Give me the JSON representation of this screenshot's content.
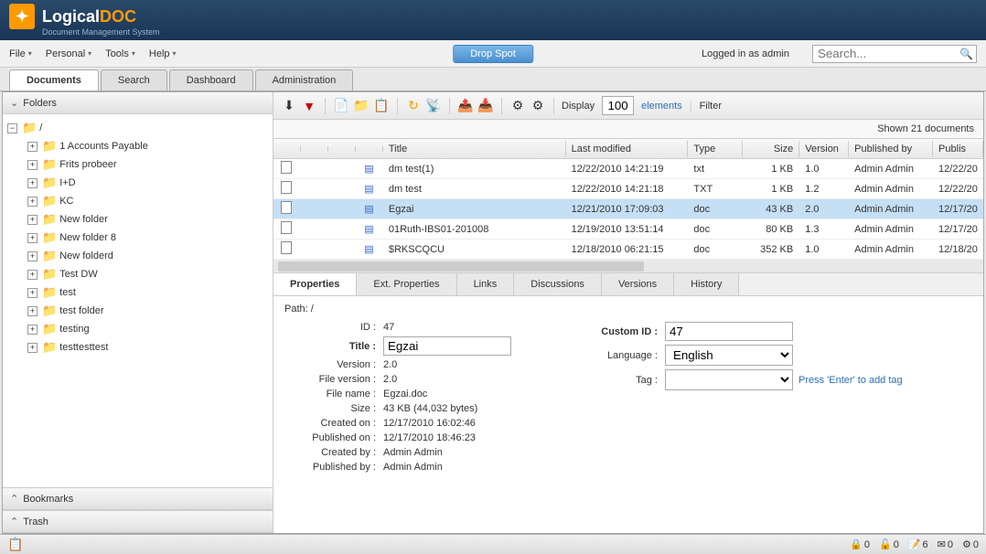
{
  "brand": {
    "name1": "Logical",
    "name2": "DOC",
    "subtitle": "Document Management System"
  },
  "menu": {
    "file": "File",
    "personal": "Personal",
    "tools": "Tools",
    "help": "Help"
  },
  "dropspot": "Drop Spot",
  "login_status": "Logged in as admin",
  "search": {
    "placeholder": "Search..."
  },
  "tabs": {
    "documents": "Documents",
    "search": "Search",
    "dashboard": "Dashboard",
    "administration": "Administration"
  },
  "sidebar": {
    "folders_title": "Folders",
    "bookmarks_title": "Bookmarks",
    "trash_title": "Trash",
    "root": "/",
    "items": [
      "1 Accounts Payable",
      "Frits probeer",
      "I+D",
      "KC",
      "New folder",
      "New folder 8",
      "New folderd",
      "Test DW",
      "test",
      "test folder",
      "testing",
      "testtesttest"
    ]
  },
  "toolbar": {
    "display_label": "Display",
    "display_value": "100",
    "elements": "elements",
    "filter": "Filter"
  },
  "shown_text": "Shown 21 documents",
  "grid": {
    "headers": {
      "title": "Title",
      "modified": "Last modified",
      "type": "Type",
      "size": "Size",
      "version": "Version",
      "pubby": "Published by",
      "pubdate": "Publis"
    },
    "rows": [
      {
        "title": "dm test(1)",
        "modified": "12/22/2010 14:21:19",
        "type": "txt",
        "size": "1 KB",
        "version": "1.0",
        "pubby": "Admin Admin",
        "pubdate": "12/22/20"
      },
      {
        "title": "dm test",
        "modified": "12/22/2010 14:21:18",
        "type": "TXT",
        "size": "1 KB",
        "version": "1.2",
        "pubby": "Admin Admin",
        "pubdate": "12/22/20"
      },
      {
        "title": "Egzai",
        "modified": "12/21/2010 17:09:03",
        "type": "doc",
        "size": "43 KB",
        "version": "2.0",
        "pubby": "Admin Admin",
        "pubdate": "12/17/20"
      },
      {
        "title": "01Ruth-IBS01-201008",
        "modified": "12/19/2010 13:51:14",
        "type": "doc",
        "size": "80 KB",
        "version": "1.3",
        "pubby": "Admin Admin",
        "pubdate": "12/17/20"
      },
      {
        "title": "$RKSCQCU",
        "modified": "12/18/2010 06:21:15",
        "type": "doc",
        "size": "352 KB",
        "version": "1.0",
        "pubby": "Admin Admin",
        "pubdate": "12/18/20"
      }
    ]
  },
  "detail_tabs": {
    "properties": "Properties",
    "ext": "Ext. Properties",
    "links": "Links",
    "discussions": "Discussions",
    "versions": "Versions",
    "history": "History"
  },
  "properties": {
    "path_label": "Path:",
    "path_value": "/",
    "id_label": "ID :",
    "id_value": "47",
    "title_label": "Title :",
    "title_value": "Egzai",
    "version_label": "Version :",
    "version_value": "2.0",
    "fileversion_label": "File version :",
    "fileversion_value": "2.0",
    "filename_label": "File name :",
    "filename_value": "Egzai.doc",
    "size_label": "Size :",
    "size_value": "43 KB (44,032 bytes)",
    "created_label": "Created on :",
    "created_value": "12/17/2010 16:02:46",
    "published_label": "Published on :",
    "published_value": "12/17/2010 18:46:23",
    "createdby_label": "Created by :",
    "createdby_value": "Admin Admin",
    "publishedby_label": "Published by :",
    "publishedby_value": "Admin Admin",
    "customid_label": "Custom ID :",
    "customid_value": "47",
    "language_label": "Language :",
    "language_value": "English",
    "tag_label": "Tag :",
    "tag_hint": "Press 'Enter' to add tag"
  },
  "footer": {
    "locked": "0",
    "checkedout": "0",
    "tasks": "6",
    "messages": "0",
    "subscriptions": "0"
  }
}
